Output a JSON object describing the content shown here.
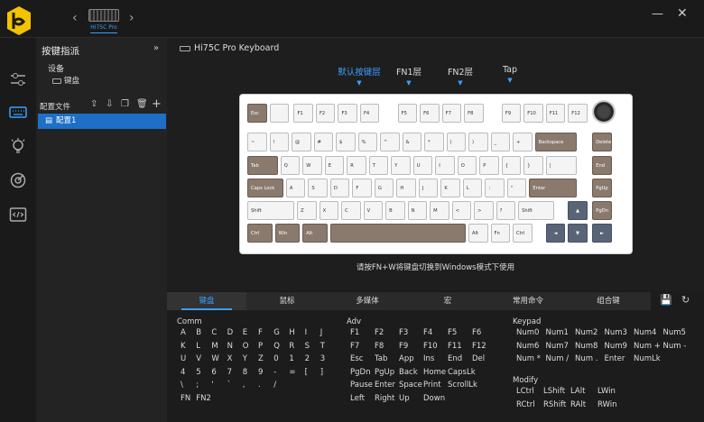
{
  "device": {
    "name": "Hi75C Pro",
    "keyboard_title": "Hi75C Pro Keyboard"
  },
  "sidebar": {
    "title": "按键指派",
    "device_label": "设备",
    "device_item": "键盘",
    "config_label": "配置文件",
    "config_item": "配置1"
  },
  "layers": [
    "默认按键层",
    "FN1层",
    "FN2层",
    "Tap"
  ],
  "hint": "请按FN+W将键盘切换到Windows模式下使用",
  "bottom_tabs": [
    "键盘",
    "鼠标",
    "多媒体",
    "宏",
    "常用命令",
    "组合键"
  ],
  "keyboard_rows": [
    [
      "Esc",
      "",
      "F1",
      "F2",
      "F3",
      "F4",
      "F5",
      "F6",
      "F7",
      "F8",
      "F9",
      "F10",
      "F11",
      "F12"
    ],
    [
      "~",
      "!",
      "@",
      "#",
      "$",
      "%",
      "^",
      "&",
      "*",
      "(",
      ")",
      "_",
      "+",
      "Backspace",
      "Delete"
    ],
    [
      "Tab",
      "Q",
      "W",
      "E",
      "R",
      "T",
      "Y",
      "U",
      "I",
      "O",
      "P",
      "{",
      "}",
      "|",
      "End"
    ],
    [
      "Caps Lock",
      "A",
      "S",
      "D",
      "F",
      "G",
      "H",
      "J",
      "K",
      "L",
      ":",
      "\"",
      "Enter",
      "PgUp"
    ],
    [
      "Shift",
      "Z",
      "X",
      "C",
      "V",
      "B",
      "N",
      "M",
      "<",
      ">",
      "?",
      "Shift",
      "",
      "PgDn"
    ],
    [
      "Ctrl",
      "Win",
      "Alt",
      "",
      "Alt",
      "Fn",
      "Ctrl",
      "",
      "",
      ""
    ]
  ],
  "groups": {
    "comm": {
      "title": "Comm",
      "rows": [
        [
          "A",
          "B",
          "C",
          "D",
          "E",
          "F",
          "G",
          "H",
          "I",
          "J"
        ],
        [
          "K",
          "L",
          "M",
          "N",
          "O",
          "P",
          "Q",
          "R",
          "S",
          "T"
        ],
        [
          "U",
          "V",
          "W",
          "X",
          "Y",
          "Z",
          "0",
          "1",
          "2",
          "3"
        ],
        [
          "4",
          "5",
          "6",
          "7",
          "8",
          "9",
          "-",
          "=",
          "[",
          "]"
        ],
        [
          "\\",
          ";",
          "'",
          "`",
          ",",
          ".",
          "/"
        ],
        [
          "FN",
          "FN2"
        ]
      ]
    },
    "adv": {
      "title": "Adv",
      "rows": [
        [
          "F1",
          "F2",
          "F3",
          "F4",
          "F5",
          "F6"
        ],
        [
          "F7",
          "F8",
          "F9",
          "F10",
          "F11",
          "F12"
        ],
        [
          "Esc",
          "Tab",
          "App",
          "Ins",
          "End",
          "Del"
        ],
        [
          "PgDn",
          "PgUp",
          "Back",
          "Home",
          "CapsLk"
        ],
        [
          "Pause",
          "Enter",
          "Space",
          "Print",
          "ScrollLk"
        ],
        [
          "Left",
          "Right",
          "Up",
          "Down"
        ]
      ]
    },
    "keypad": {
      "title": "Keypad",
      "rows": [
        [
          "Num0",
          "Num1",
          "Num2",
          "Num3",
          "Num4",
          "Num5"
        ],
        [
          "Num6",
          "Num7",
          "Num8",
          "Num9",
          "Num +",
          "Num -"
        ],
        [
          "Num *",
          "Num /",
          "Num .",
          "Enter",
          "NumLk"
        ]
      ]
    },
    "modify": {
      "title": "Modify",
      "rows": [
        [
          "LCtrl",
          "LShift",
          "LAlt",
          "LWin"
        ],
        [
          "RCtrl",
          "RShift",
          "RAlt",
          "RWin"
        ]
      ]
    }
  }
}
